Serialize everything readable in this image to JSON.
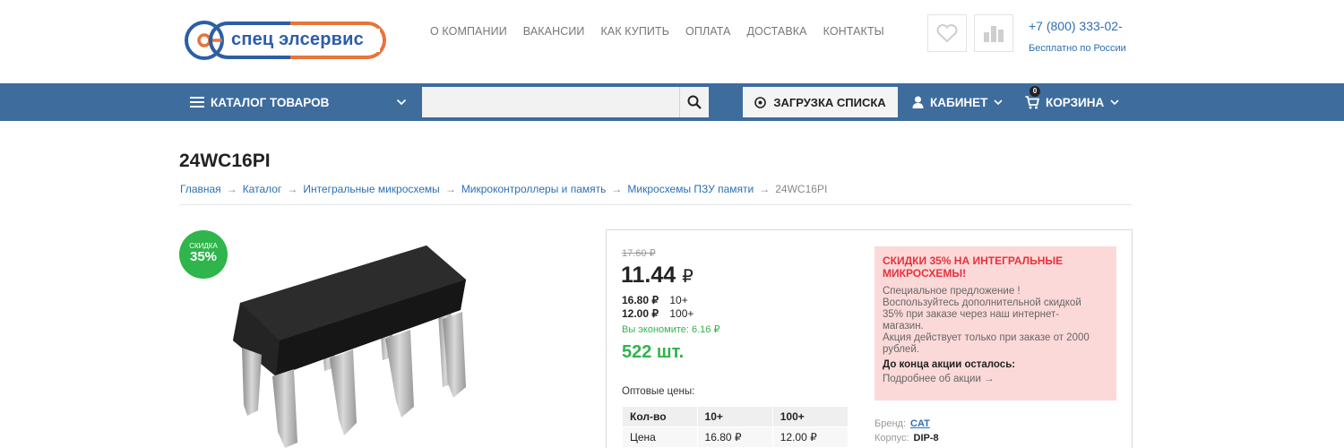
{
  "header": {
    "logo_text": "спец элсервис",
    "nav": [
      "О КОМПАНИИ",
      "ВАКАНСИИ",
      "КАК КУПИТЬ",
      "ОПЛАТА",
      "ДОСТАВКА",
      "КОНТАКТЫ"
    ],
    "phone": "+7 (800) 333-02-",
    "phone_note": "Бесплатно по России",
    "colors": {
      "brand_blue": "#2b5ea8",
      "brand_orange": "#e8743b"
    }
  },
  "toolbar": {
    "catalog_label": "КАТАЛОГ ТОВАРОВ",
    "search_placeholder": "",
    "upload_label": "ЗАГРУЗКА СПИСКА",
    "cabinet_label": "КАБИНЕТ",
    "cart_label": "КОРЗИНА",
    "cart_count": "0",
    "bar_color": "#3e6c9d"
  },
  "page": {
    "title": "24WC16PI",
    "breadcrumbs": [
      "Главная",
      "Каталог",
      "Интегральные микросхемы",
      "Микроконтроллеры и память",
      "Микросхемы ПЗУ памяти"
    ],
    "breadcrumb_current": "24WC16PI"
  },
  "product": {
    "discount_label": "СКИДКА",
    "discount_value": "35%",
    "old_price": "17.60 ₽",
    "price": "11.44",
    "currency": "₽",
    "tiers": [
      {
        "price": "16.80 ₽",
        "qty": "10+"
      },
      {
        "price": "12.00 ₽",
        "qty": "100+"
      }
    ],
    "savings": "Вы экономите: 6.16 ₽",
    "stock": "522 шт.",
    "wholesale_label": "Оптовые цены:",
    "wholesale_table": {
      "headers": [
        "Кол-во",
        "10+",
        "100+"
      ],
      "rows": [
        [
          "Цена",
          "16.80 ₽",
          "12.00 ₽"
        ]
      ]
    },
    "promo": {
      "title": "СКИДКИ 35% НА ИНТЕГРАЛЬНЫЕ МИКРОСХЕМЫ!",
      "line1": "Специальное предложение !",
      "line2": "Воспользуйтесь дополнительной скидкой",
      "line3": "35%  при заказе через наш интернет-",
      "line4": "магазин.",
      "line5": "Акция действует только при заказе от 2000",
      "line6": "рублей.",
      "countdown_label": "До конца акции осталось:",
      "link": "Подробнее об акции →"
    },
    "brand_label": "Бренд:",
    "brand": "CAT",
    "package_label": "Корпус:",
    "package": "DIP-8"
  }
}
